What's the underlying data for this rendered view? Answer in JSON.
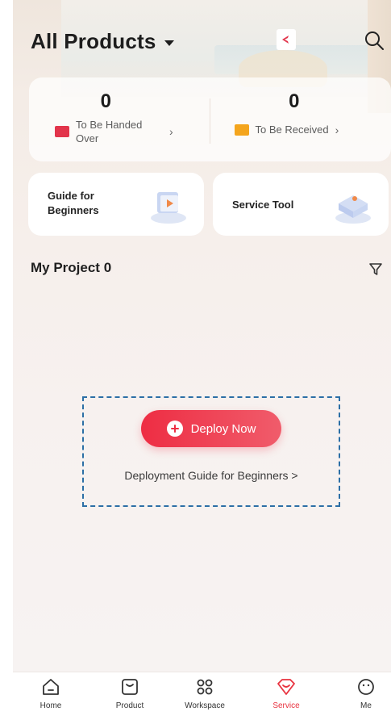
{
  "header": {
    "title": "All Products"
  },
  "stats": {
    "handed_over": {
      "count": "0",
      "label": "To Be Handed Over"
    },
    "received": {
      "count": "0",
      "label": "To Be Received"
    }
  },
  "tiles": {
    "guide": {
      "label": "Guide for Beginners"
    },
    "service_tool": {
      "label": "Service Tool"
    }
  },
  "project": {
    "title": "My Project 0"
  },
  "empty_state": {
    "deploy_label": "Deploy Now",
    "guide_link": "Deployment Guide for Beginners >"
  },
  "tabs": [
    {
      "label": "Home",
      "icon": "home-icon"
    },
    {
      "label": "Product",
      "icon": "product-icon"
    },
    {
      "label": "Workspace",
      "icon": "workspace-icon"
    },
    {
      "label": "Service",
      "icon": "service-icon",
      "active": true
    },
    {
      "label": "Me",
      "icon": "me-icon"
    }
  ],
  "colors": {
    "accent": "#e8323f",
    "dashed_outline": "#2c6fa6"
  }
}
